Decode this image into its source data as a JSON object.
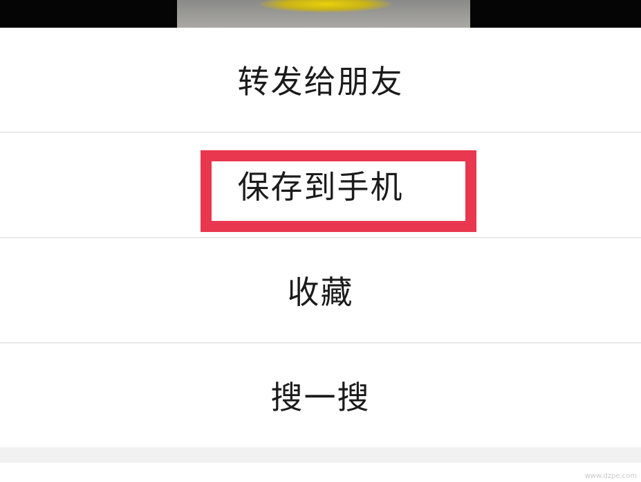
{
  "menu": {
    "items": [
      {
        "label": "转发给朋友"
      },
      {
        "label": "保存到手机"
      },
      {
        "label": "收藏"
      },
      {
        "label": "搜一搜"
      }
    ]
  },
  "annotation": {
    "color": "#e8374e",
    "highlighted_item": "保存到手机"
  },
  "watermark": {
    "text": "www.dzpe.com"
  }
}
